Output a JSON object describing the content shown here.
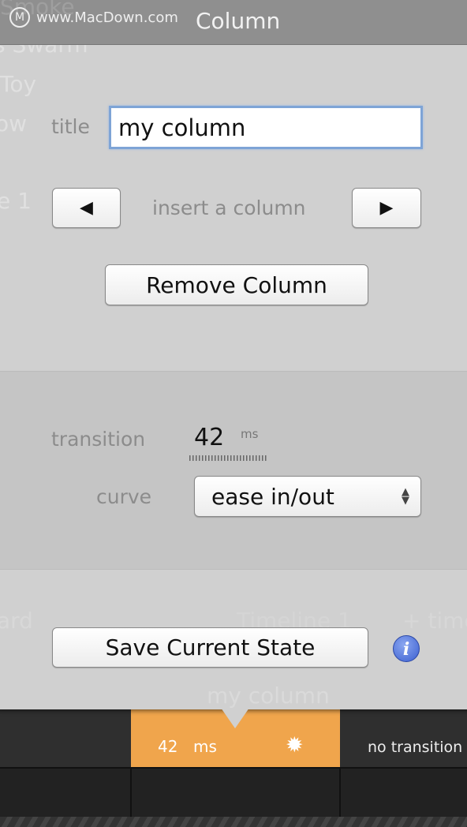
{
  "window": {
    "title": "Column",
    "watermark": "www.MacDown.com"
  },
  "background": {
    "ghost_items": [
      "Smoke",
      "s Swarm",
      "Toy",
      "ow",
      "e 1",
      "ard",
      "Timeline 1",
      "+ time",
      "my column"
    ],
    "timeline": {
      "transition_value": "42",
      "transition_unit": "ms",
      "next_cell": "no transition",
      "accent": "#f0a54c"
    }
  },
  "form": {
    "title_label": "title",
    "title_value": "my column",
    "insert_label": "insert a column",
    "remove_button": "Remove Column",
    "transition_label": "transition",
    "transition_value": "42",
    "transition_unit": "ms",
    "curve_label": "curve",
    "curve_value": "ease in/out",
    "save_button": "Save Current State",
    "info_icon": "i"
  }
}
